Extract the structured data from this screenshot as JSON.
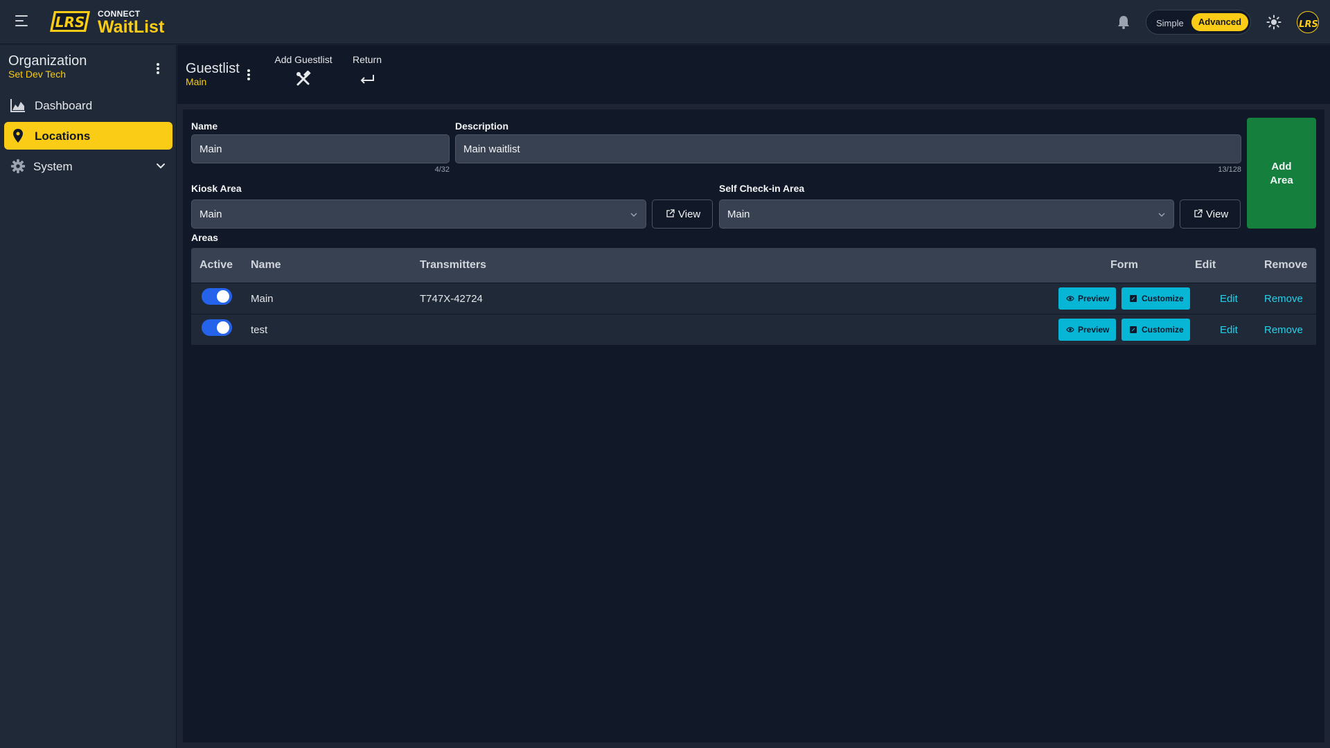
{
  "header": {
    "brand_small": "CONNECT",
    "brand_big": "WaitList",
    "logo_text": "LRS",
    "mode": {
      "simple": "Simple",
      "advanced": "Advanced",
      "selected": "Advanced"
    },
    "icons": [
      "menu-icon",
      "bell-icon",
      "sun-icon",
      "avatar"
    ]
  },
  "sidebar": {
    "org_title": "Organization",
    "org_sub": "Set Dev Tech",
    "items": [
      {
        "label": "Dashboard",
        "icon": "chart-area-icon",
        "active": false
      },
      {
        "label": "Locations",
        "icon": "map-pin-icon",
        "active": true
      },
      {
        "label": "System",
        "icon": "gear-icon",
        "active": false,
        "expandable": true
      }
    ]
  },
  "content_header": {
    "title": "Guestlist",
    "subtitle": "Main",
    "tools": [
      {
        "label": "Add Guestlist",
        "icon": "tools-icon"
      },
      {
        "label": "Return",
        "icon": "return-icon"
      }
    ]
  },
  "form": {
    "name_label": "Name",
    "name_value": "Main",
    "name_counter": "4/32",
    "description_label": "Description",
    "description_value": "Main waitlist",
    "description_counter": "13/128",
    "kiosk_label": "Kiosk Area",
    "kiosk_value": "Main",
    "selfcheck_label": "Self Check-in Area",
    "selfcheck_value": "Main",
    "view_label": "View",
    "add_area_line1": "Add",
    "add_area_line2": "Area"
  },
  "areas": {
    "label": "Areas",
    "columns": [
      "Active",
      "Name",
      "Transmitters",
      "Form",
      "Edit",
      "Remove"
    ],
    "rows": [
      {
        "active": true,
        "name": "Main",
        "transmitters": "T747X-42724"
      },
      {
        "active": true,
        "name": "test",
        "transmitters": ""
      }
    ],
    "preview_label": "Preview",
    "customize_label": "Customize",
    "edit_label": "Edit",
    "remove_label": "Remove"
  },
  "colors": {
    "accent": "#facc15",
    "success": "#15803d",
    "info": "#06b6d4",
    "toggle": "#2563eb"
  }
}
